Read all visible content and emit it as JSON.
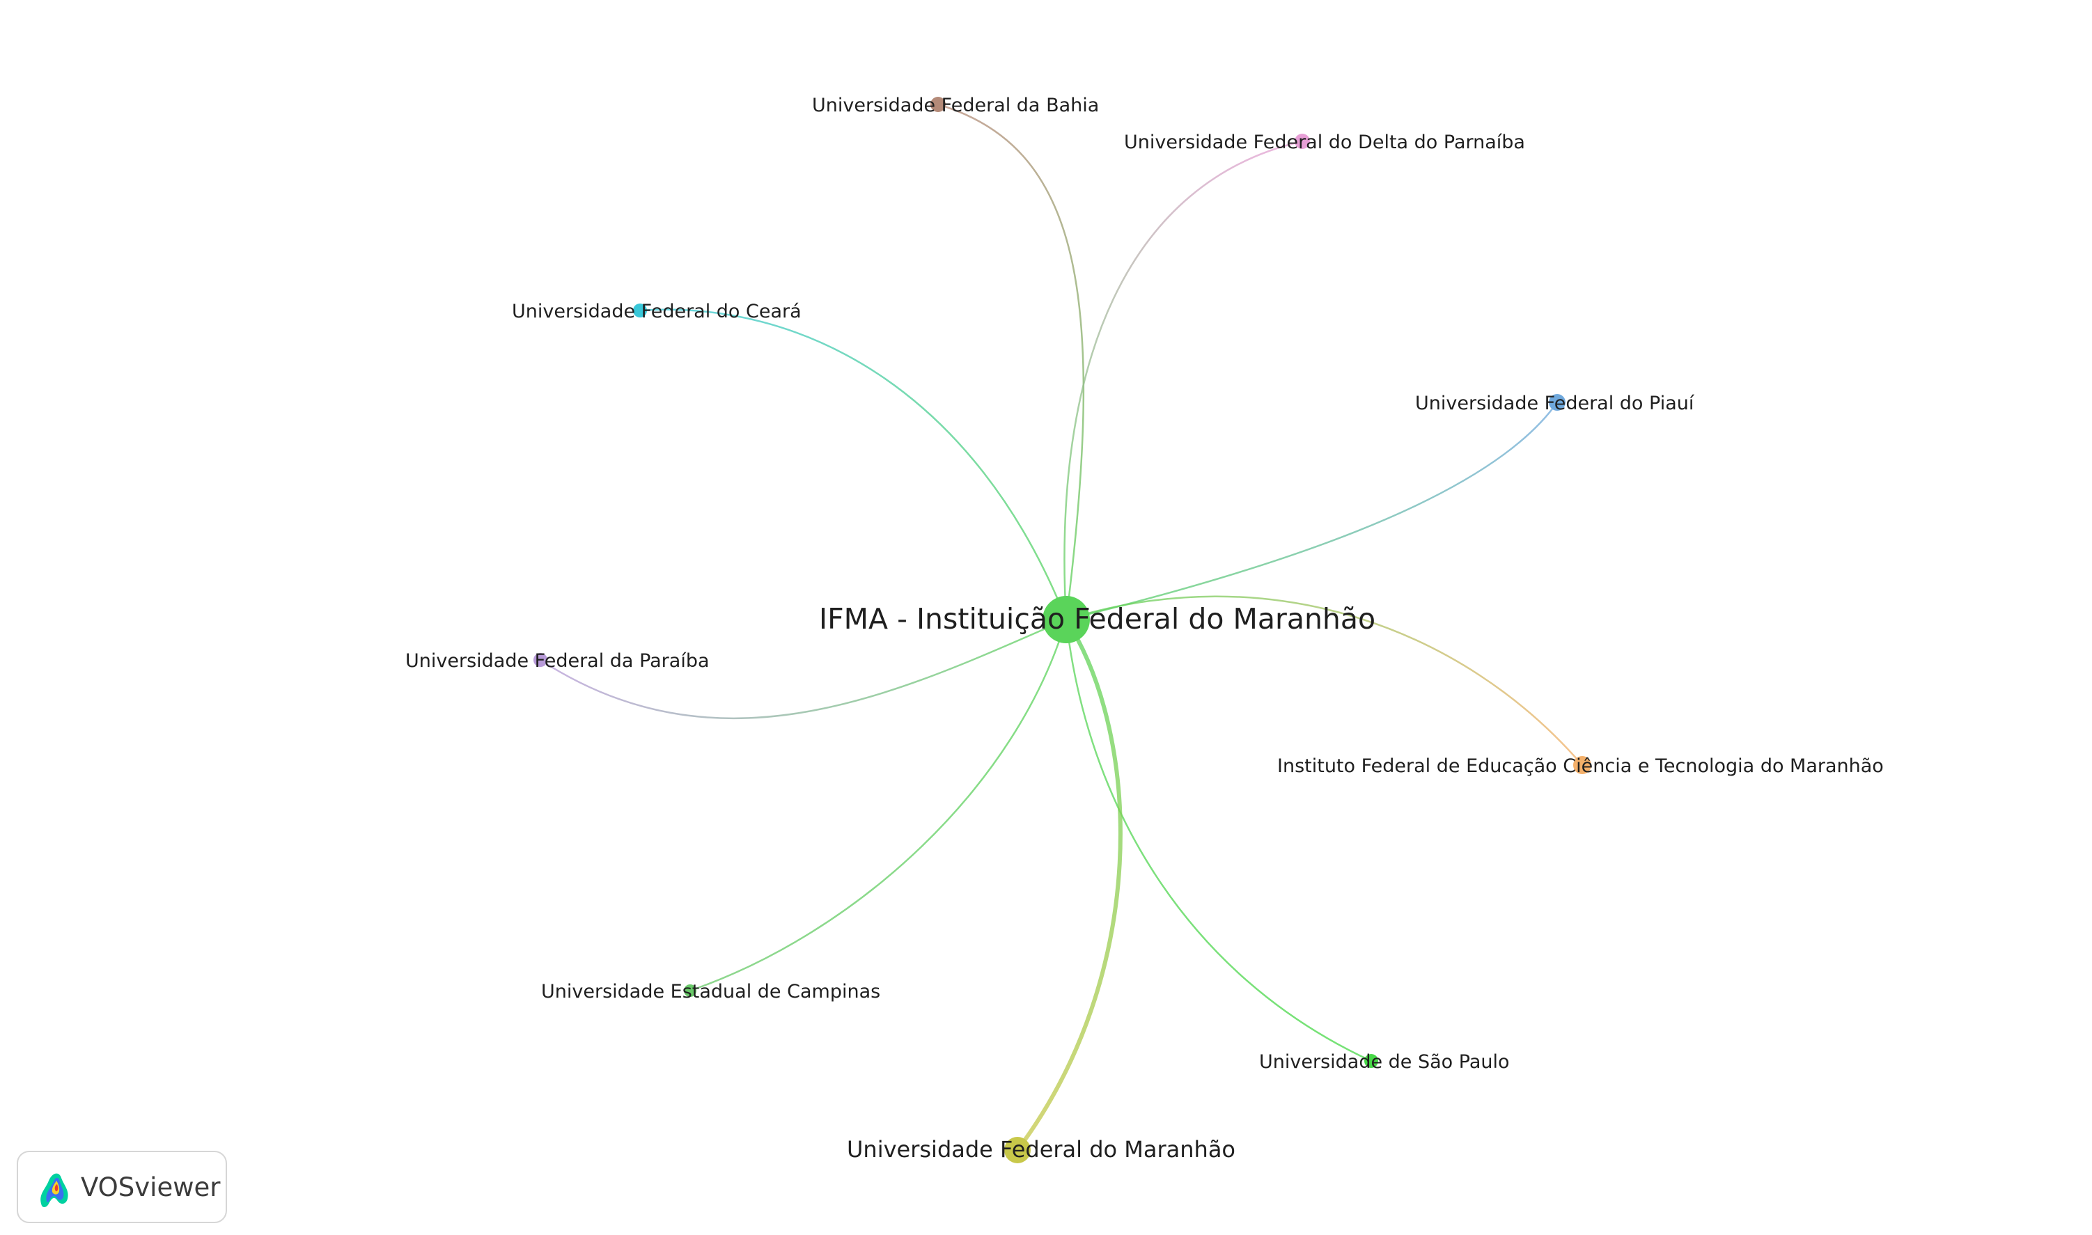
{
  "network": {
    "center": {
      "label": "IFMA - Instituição Federal do Maranhão",
      "color": "#5ad45a"
    },
    "nodes": [
      {
        "id": "ufba",
        "label": "Universidade Federal da Bahia",
        "color": "#b48a78"
      },
      {
        "id": "ufdpar",
        "label": "Universidade Federal do Delta do Parnaíba",
        "color": "#e79fd6"
      },
      {
        "id": "ufc",
        "label": "Universidade Federal do Ceará",
        "color": "#39c7d8"
      },
      {
        "id": "ufpi",
        "label": "Universidade Federal do Piauí",
        "color": "#6fa8dc"
      },
      {
        "id": "ufpb",
        "label": "Universidade Federal da Paraíba",
        "color": "#b79ad8"
      },
      {
        "id": "ifma-edu",
        "label": "Instituto Federal de Educação Ciência e Tecnologia do Maranhão",
        "color": "#f4b06a"
      },
      {
        "id": "unicamp",
        "label": "Universidade Estadual de Campinas",
        "color": "#69c969"
      },
      {
        "id": "usp",
        "label": "Universidade de São Paulo",
        "color": "#47d847"
      },
      {
        "id": "ufma",
        "label": "Universidade Federal do Maranhão",
        "color": "#c8c84a"
      }
    ]
  },
  "brand": {
    "name": "VOSviewer"
  }
}
